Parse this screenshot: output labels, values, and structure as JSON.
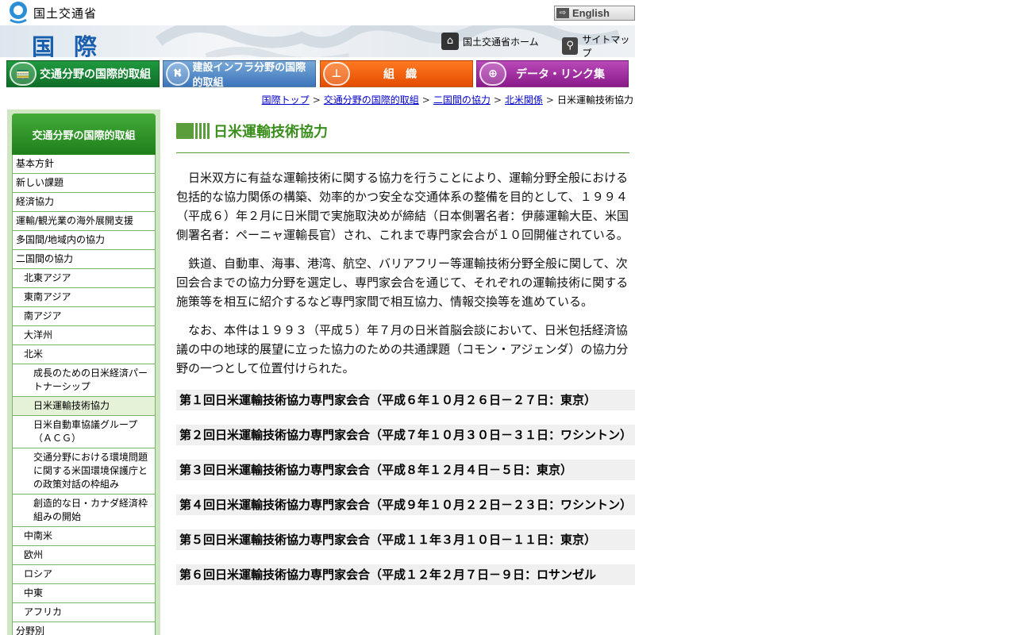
{
  "header": {
    "ministry_name": "国土交通省",
    "english_label": "English",
    "section_title": "国際",
    "home_link": "国土交通省ホーム",
    "sitemap_link": "サイトマップ"
  },
  "nav": [
    {
      "label": "交通分野の国際的取組",
      "icon": "train-icon"
    },
    {
      "label": "建設インフラ分野の国際的取組",
      "icon": "road-icon"
    },
    {
      "label": "組　織",
      "icon": "org-chart-icon"
    },
    {
      "label": "データ・リンク集",
      "icon": "globe-icon"
    }
  ],
  "breadcrumb": [
    "国際トップ",
    "交通分野の国際的取組",
    "二国間の協力",
    "北米関係",
    "日米運輸技術協力"
  ],
  "sidebar": {
    "heading": "交通分野の国際的取組",
    "items": [
      {
        "label": "基本方針",
        "level": 0
      },
      {
        "label": "新しい課題",
        "level": 0
      },
      {
        "label": "経済協力",
        "level": 0
      },
      {
        "label": "運輸/観光業の海外展開支援",
        "level": 0
      },
      {
        "label": "多国間/地域内の協力",
        "level": 0
      },
      {
        "label": "二国間の協力",
        "level": 0
      },
      {
        "label": "北東アジア",
        "level": 1
      },
      {
        "label": "東南アジア",
        "level": 1
      },
      {
        "label": "南アジア",
        "level": 1
      },
      {
        "label": "大洋州",
        "level": 1
      },
      {
        "label": "北米",
        "level": 1
      },
      {
        "label": "成長のための日米経済パートナーシップ",
        "level": 2
      },
      {
        "label": "日米運輸技術協力",
        "level": 2,
        "current": true
      },
      {
        "label": "日米自動車協議グループ（ＡＣＧ）",
        "level": 2
      },
      {
        "label": "交通分野における環境問題に関する米国環境保護庁との政策対話の枠組み",
        "level": 2
      },
      {
        "label": "創造的な日・カナダ経済枠組みの開始",
        "level": 2
      },
      {
        "label": "中南米",
        "level": 1
      },
      {
        "label": "欧州",
        "level": 1
      },
      {
        "label": "ロシア",
        "level": 1
      },
      {
        "label": "中東",
        "level": 1
      },
      {
        "label": "アフリカ",
        "level": 1
      },
      {
        "label": "分野別",
        "level": 0
      }
    ]
  },
  "main": {
    "title": "日米運輸技術協力",
    "paragraphs": [
      "日米双方に有益な運輸技術に関する協力を行うことにより、運輸分野全般における包括的な協力関係の構築、効率的かつ安全な交通体系の整備を目的として、１９９４（平成６）年２月に日米間で実施取決めが締結（日本側署名者：伊藤運輸大臣、米国側署名者：ペーニャ運輸長官）され、これまで専門家会合が１０回開催されている。",
      "鉄道、自動車、海事、港湾、航空、バリアフリー等運輸技術分野全般に関して、次回会合までの協力分野を選定し、専門家会合を通じて、それぞれの運輸技術に関する施策等を相互に紹介するなど専門家間で相互協力、情報交換等を進めている。",
      "なお、本件は１９９３（平成５）年７月の日米首脳会談において、日米包括経済協議の中の地球的展望に立った協力のための共通課題（コモン・アジェンダ）の協力分野の一つとして位置付けられた。"
    ],
    "meetings": [
      "第１回日米運輸技術協力専門家会合（平成６年１０月２６日－２７日：東京）",
      "第２回日米運輸技術協力専門家会合（平成７年１０月３０日－３１日：ワシントン）",
      "第３回日米運輸技術協力専門家会合（平成８年１２月４日－５日：東京）",
      "第４回日米運輸技術協力専門家会合（平成９年１０月２２日－２３日：ワシントン）",
      "第５回日米運輸技術協力専門家会合（平成１１年３月１０日－１１日：東京）",
      "第６回日米運輸技術協力専門家会合（平成１２年２月７日－９日：ロサンゼル"
    ]
  }
}
